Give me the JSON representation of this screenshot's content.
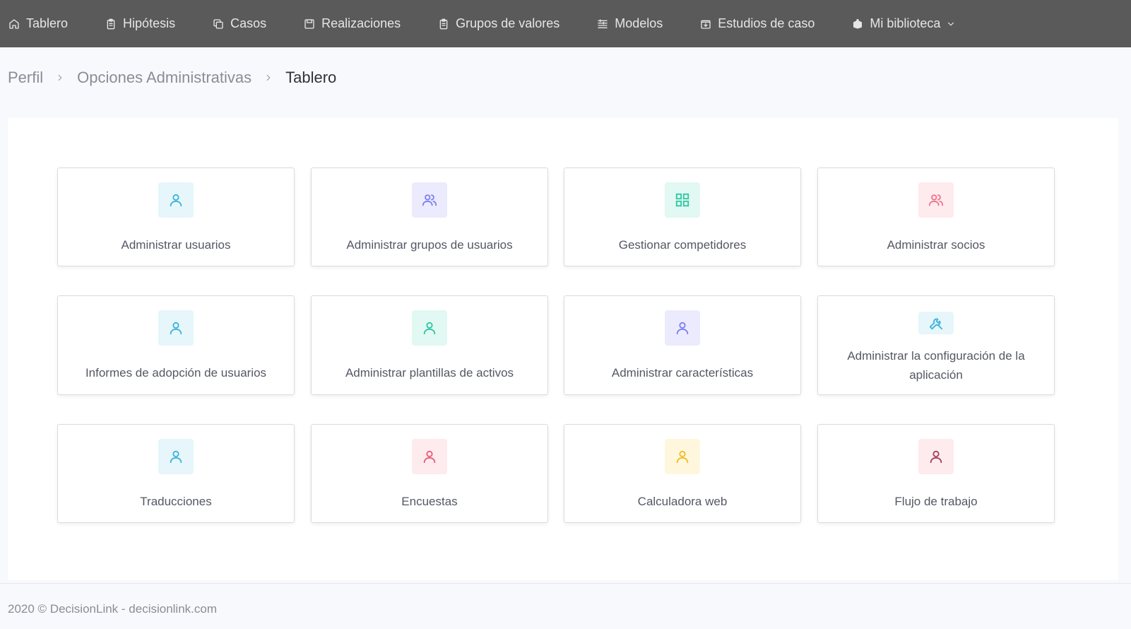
{
  "nav": {
    "items": [
      {
        "label": "Tablero",
        "icon": "home-icon"
      },
      {
        "label": "Hipótesis",
        "icon": "clipboard-icon"
      },
      {
        "label": "Casos",
        "icon": "copy-icon"
      },
      {
        "label": "Realizaciones",
        "icon": "save-icon"
      },
      {
        "label": "Grupos de valores",
        "icon": "clipboard-icon"
      },
      {
        "label": "Modelos",
        "icon": "list-icon"
      },
      {
        "label": "Estudios de caso",
        "icon": "folder-icon"
      },
      {
        "label": "Mi biblioteca",
        "icon": "book-icon",
        "dropdown": true
      }
    ]
  },
  "breadcrumb": {
    "items": [
      "Perfil",
      "Opciones Administrativas",
      "Tablero"
    ]
  },
  "tiles": [
    {
      "label": "Administrar usuarios",
      "icon": "user-icon",
      "bg": "#e6f6fb",
      "fg": "#3bb4d8"
    },
    {
      "label": "Administrar grupos de usuarios",
      "icon": "users-icon",
      "bg": "#ebebfd",
      "fg": "#7c7ff0"
    },
    {
      "label": "Gestionar competidores",
      "icon": "grid-icon",
      "bg": "#e2f8f2",
      "fg": "#2ec7a3"
    },
    {
      "label": "Administrar socios",
      "icon": "users-icon",
      "bg": "#fdebee",
      "fg": "#f0738b"
    },
    {
      "label": "Informes de adopción de usuarios",
      "icon": "user-icon",
      "bg": "#e6f6fb",
      "fg": "#3bb4d8"
    },
    {
      "label": "Administrar plantillas de activos",
      "icon": "user-icon",
      "bg": "#e2f8f2",
      "fg": "#2ec7a3"
    },
    {
      "label": "Administrar características",
      "icon": "user-icon",
      "bg": "#ebebfd",
      "fg": "#7c7ff0"
    },
    {
      "label": "Administrar la configuración de la aplicación",
      "icon": "tool-icon",
      "bg": "#e6f6fb",
      "fg": "#3bb4d8"
    },
    {
      "label": "Traducciones",
      "icon": "user-icon",
      "bg": "#e6f6fb",
      "fg": "#3bb4d8"
    },
    {
      "label": "Encuestas",
      "icon": "user-icon",
      "bg": "#fdebee",
      "fg": "#ee5a78"
    },
    {
      "label": "Calculadora web",
      "icon": "user-icon",
      "bg": "#fff7dd",
      "fg": "#f2bb24"
    },
    {
      "label": "Flujo de trabajo",
      "icon": "user-icon",
      "bg": "#fdebee",
      "fg": "#a4405a"
    }
  ],
  "footer": {
    "text": "2020 © DecisionLink - decisionlink.com"
  }
}
